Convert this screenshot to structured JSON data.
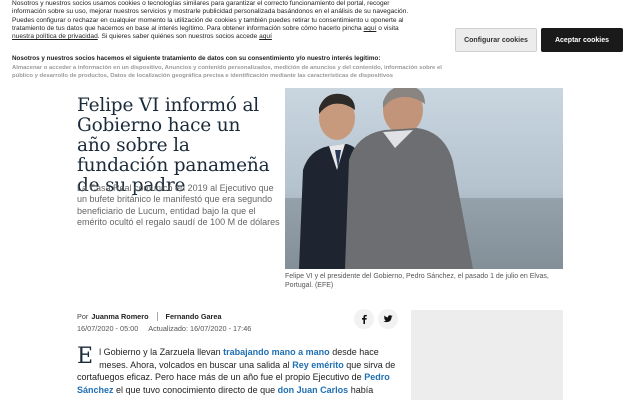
{
  "cookie_banner": {
    "text_1": "Nosotros y nuestros socios usamos cookies o tecnologías similares para garantizar el correcto funcionamiento del portal, recoger información sobre su uso, mejorar nuestros servicios y mostrarle publicidad personalizada basándonos en el análisis de su navegación.",
    "text_2": "Puedes configurar o rechazar en cualquier momento la utilización de cookies y también puedes retirar tu consentimiento u oponerte al tratamiento de tus datos que hacemos en base al interés legítimo. Para obtener información sobre cómo hacerlo pincha",
    "link_aqui_1": "aquí",
    "text_3": "o visita",
    "link_privacy": "nuestra política de privacidad",
    "text_4": ". Si quieres saber quiénes son nuestros socios accede",
    "link_aqui_2": "aquí",
    "sub_title": "Nosotros y nuestros socios hacemos el siguiente tratamiento de datos con su consentimiento y/o nuestro interés legítimo:",
    "sub_list": "Almacenar o acceder a información en un dispositivo, Anuncios y contenido personalizados, medición de anuncios y del contenido, información sobre el público y desarrollo de productos, Datos de localización geográfica precisa e identificación mediante las características de dispositivos",
    "configure_label": "Configurar cookies",
    "accept_label": "Aceptar cookies"
  },
  "article": {
    "headline": "Felipe VI informó al Gobierno hace un año sobre la fundación panameña de su padre",
    "subheadline": "La Casa Real comunicó en 2019 al Ejecutivo que un bufete británico le manifestó que era segundo beneficiario de Lucum, entidad bajo la que el emérito ocultó el regalo saudí de 100 M de dólares",
    "photo_caption": "Felipe VI y el presidente del Gobierno, Pedro Sánchez, el pasado 1 de julio en Elvas, Portugal. (EFE)",
    "byline": {
      "by": "Por",
      "author_1": "Juanma Romero",
      "author_2": "Fernando Garea"
    },
    "published": "16/07/2020 - 05:00",
    "updated": "Actualizado: 16/07/2020 - 17:46",
    "body": {
      "drop_cap": "E",
      "t1": "l Gobierno y la Zarzuela llevan",
      "l1": "trabajando mano a mano",
      "t2": "desde hace meses. Ahora, volcados en buscar una salida al",
      "l2": "Rey emérito",
      "t3": "que sirva de cortafuegos eficaz. Pero hace más de un año fue el propio Ejecutivo de",
      "l3": "Pedro Sánchez",
      "t4": "el que tuvo conocimiento directo de que",
      "l4": "don Juan Carlos",
      "t5": "había"
    }
  },
  "share": {
    "facebook_icon": "facebook-icon",
    "twitter_icon": "twitter-icon"
  }
}
